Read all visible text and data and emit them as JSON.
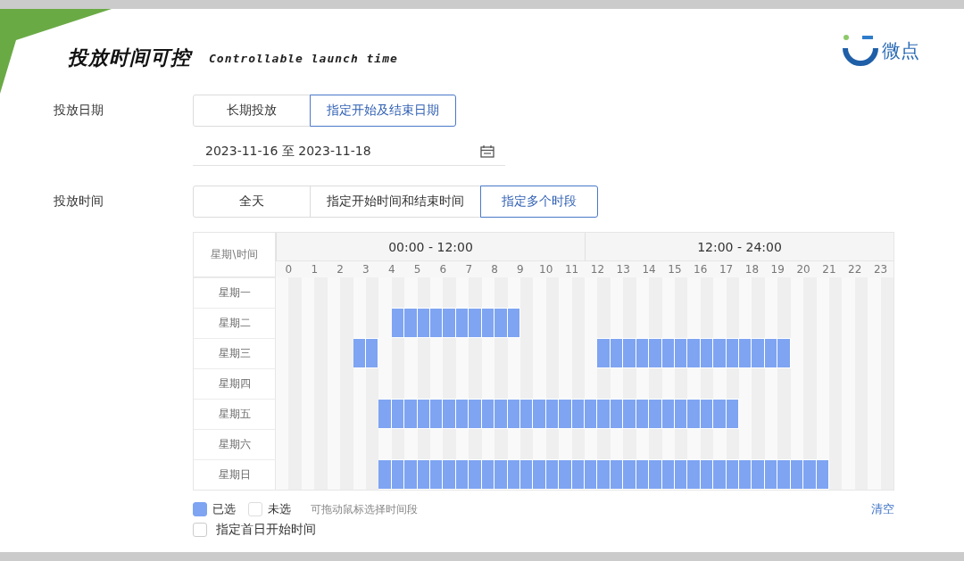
{
  "title": "投放时间可控",
  "subtitle": "Controllable launch time",
  "logo": {
    "text": "微点"
  },
  "date_row": {
    "label": "投放日期",
    "options": [
      {
        "label": "长期投放",
        "selected": false
      },
      {
        "label": "指定开始及结束日期",
        "selected": true
      }
    ],
    "date_range": "2023-11-16 至 2023-11-18"
  },
  "time_row": {
    "label": "投放时间",
    "options": [
      {
        "label": "全天",
        "selected": false
      },
      {
        "label": "指定开始时间和结束时间",
        "selected": false
      },
      {
        "label": "指定多个时段",
        "selected": true
      }
    ]
  },
  "schedule": {
    "corner": "星期\\时间",
    "ranges": [
      "00:00 - 12:00",
      "12:00 - 24:00"
    ],
    "hours": [
      "0",
      "1",
      "2",
      "3",
      "4",
      "5",
      "6",
      "7",
      "8",
      "9",
      "10",
      "11",
      "12",
      "13",
      "14",
      "15",
      "16",
      "17",
      "18",
      "19",
      "20",
      "21",
      "22",
      "23"
    ],
    "rows": [
      {
        "day": "星期一",
        "slots": [
          false,
          false,
          false,
          false,
          false,
          false,
          false,
          false,
          false,
          false,
          false,
          false,
          false,
          false,
          false,
          false,
          false,
          false,
          false,
          false,
          false,
          false,
          false,
          false,
          false,
          false,
          false,
          false,
          false,
          false,
          false,
          false,
          false,
          false,
          false,
          false,
          false,
          false,
          false,
          false,
          false,
          false,
          false,
          false,
          false,
          false,
          false,
          false
        ]
      },
      {
        "day": "星期二",
        "slots": [
          false,
          false,
          false,
          false,
          false,
          false,
          false,
          false,
          false,
          true,
          true,
          true,
          true,
          true,
          true,
          true,
          true,
          true,
          true,
          false,
          false,
          false,
          false,
          false,
          false,
          false,
          false,
          false,
          false,
          false,
          false,
          false,
          false,
          false,
          false,
          false,
          false,
          false,
          false,
          false,
          false,
          false,
          false,
          false,
          false,
          false,
          false,
          false
        ]
      },
      {
        "day": "星期三",
        "slots": [
          false,
          false,
          false,
          false,
          false,
          false,
          true,
          true,
          false,
          false,
          false,
          false,
          false,
          false,
          false,
          false,
          false,
          false,
          false,
          false,
          false,
          false,
          false,
          false,
          false,
          true,
          true,
          true,
          true,
          true,
          true,
          true,
          true,
          true,
          true,
          true,
          true,
          true,
          true,
          true,
          false,
          false,
          false,
          false,
          false,
          false,
          false,
          false
        ]
      },
      {
        "day": "星期四",
        "slots": [
          false,
          false,
          false,
          false,
          false,
          false,
          false,
          false,
          false,
          false,
          false,
          false,
          false,
          false,
          false,
          false,
          false,
          false,
          false,
          false,
          false,
          false,
          false,
          false,
          false,
          false,
          false,
          false,
          false,
          false,
          false,
          false,
          false,
          false,
          false,
          false,
          false,
          false,
          false,
          false,
          false,
          false,
          false,
          false,
          false,
          false,
          false,
          false
        ]
      },
      {
        "day": "星期五",
        "slots": [
          false,
          false,
          false,
          false,
          false,
          false,
          false,
          false,
          true,
          true,
          true,
          true,
          true,
          true,
          true,
          true,
          true,
          true,
          true,
          true,
          true,
          true,
          true,
          true,
          true,
          true,
          true,
          true,
          true,
          true,
          true,
          true,
          true,
          true,
          true,
          true,
          false,
          false,
          false,
          false,
          false,
          false,
          false,
          false,
          false,
          false,
          false,
          false
        ]
      },
      {
        "day": "星期六",
        "slots": [
          false,
          false,
          false,
          false,
          false,
          false,
          false,
          false,
          false,
          false,
          false,
          false,
          false,
          false,
          false,
          false,
          false,
          false,
          false,
          false,
          false,
          false,
          false,
          false,
          false,
          false,
          false,
          false,
          false,
          false,
          false,
          false,
          false,
          false,
          false,
          false,
          false,
          false,
          false,
          false,
          false,
          false,
          false,
          false,
          false,
          false,
          false,
          false
        ]
      },
      {
        "day": "星期日",
        "slots": [
          false,
          false,
          false,
          false,
          false,
          false,
          false,
          false,
          true,
          true,
          true,
          true,
          true,
          true,
          true,
          true,
          true,
          true,
          true,
          true,
          true,
          true,
          true,
          true,
          true,
          true,
          true,
          true,
          true,
          true,
          true,
          true,
          true,
          true,
          true,
          true,
          true,
          true,
          true,
          true,
          true,
          true,
          true,
          false,
          false,
          false,
          false,
          false
        ]
      }
    ]
  },
  "legend": {
    "selected_label": "已选",
    "unselected_label": "未选",
    "hint": "可拖动鼠标选择时间段",
    "clear": "清空"
  },
  "first_day_option": {
    "label": "指定首日开始时间",
    "checked": false
  }
}
